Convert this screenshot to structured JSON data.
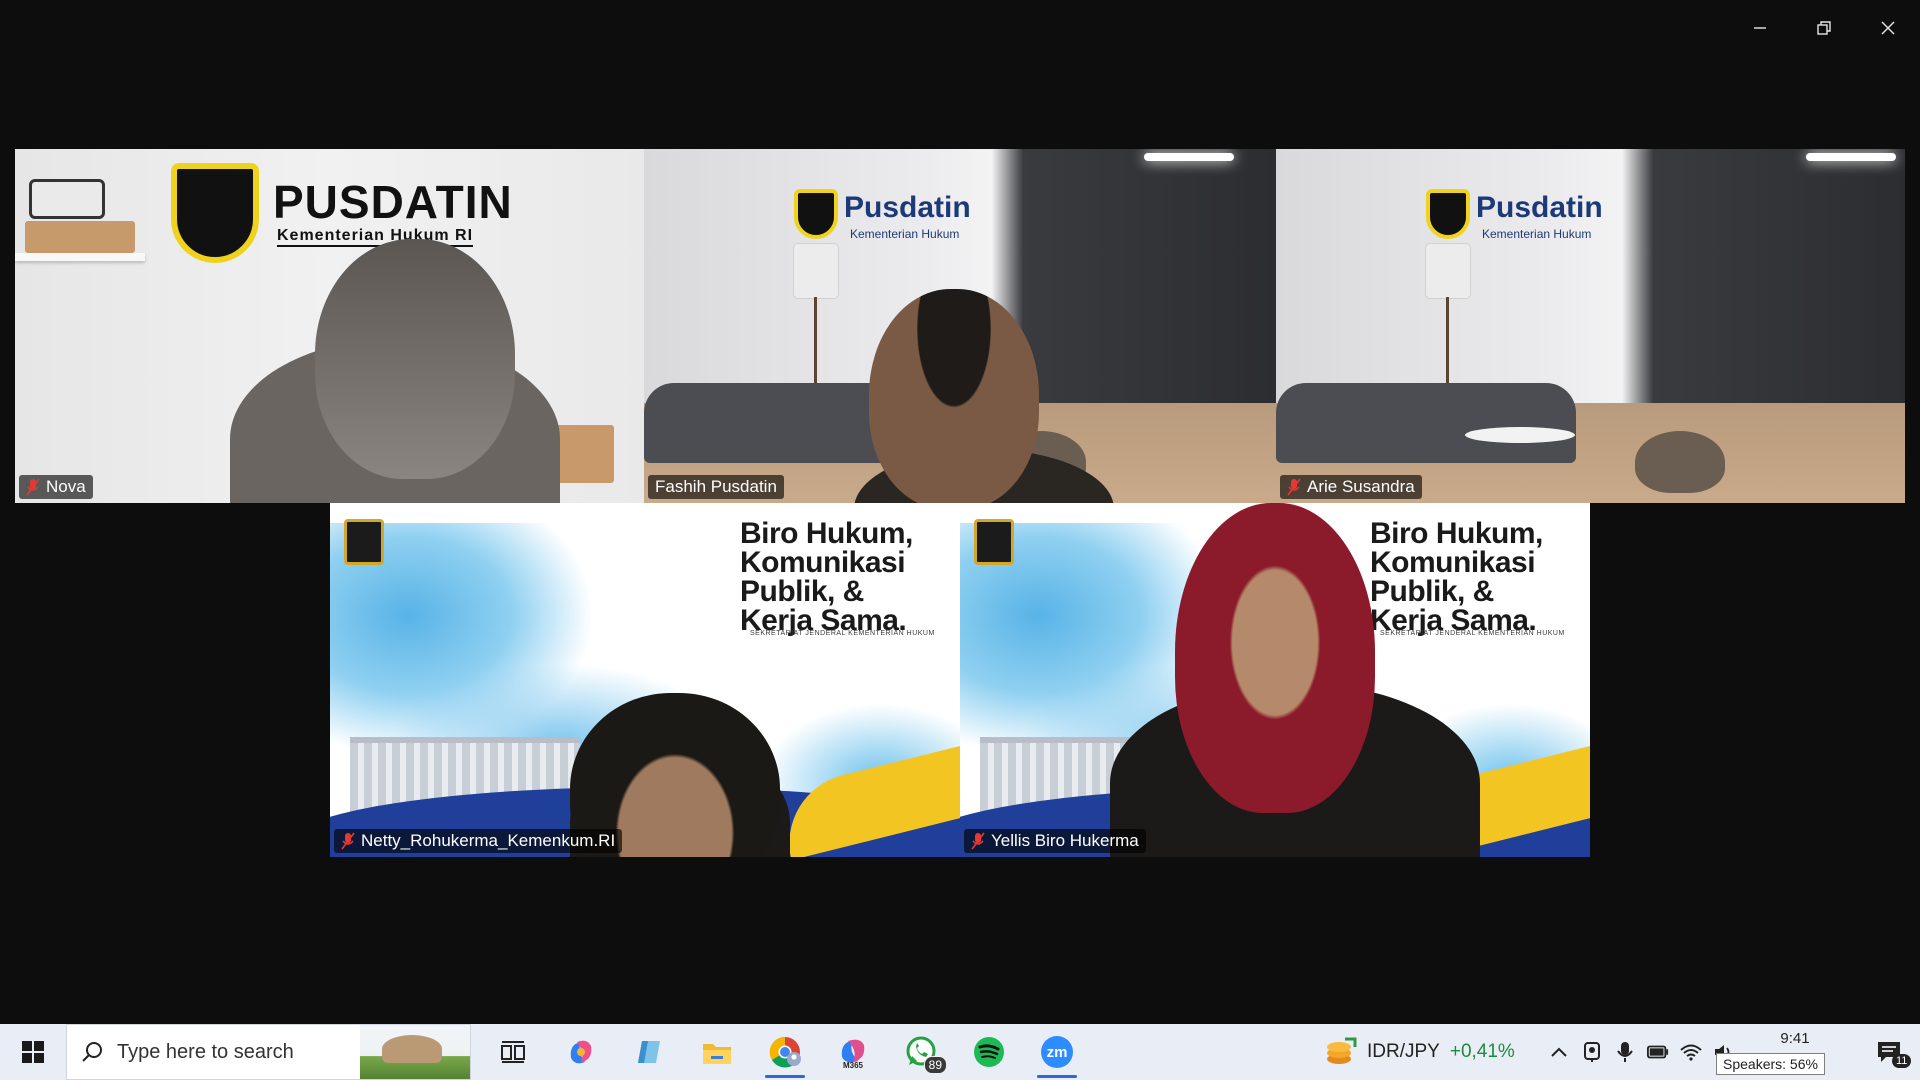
{
  "window": {
    "controls": [
      "minimize",
      "restore",
      "close"
    ]
  },
  "participants": [
    {
      "name": "Nova",
      "muted": true,
      "active": false,
      "background": "pusdatin-shelf"
    },
    {
      "name": "Fashih Pusdatin",
      "muted": false,
      "active": true,
      "background": "pusdatin-office"
    },
    {
      "name": "Arie Susandra",
      "muted": true,
      "active": false,
      "background": "pusdatin-office"
    },
    {
      "name": "Netty_Rohukerma_Kemenkum.RI",
      "muted": true,
      "active": false,
      "background": "biro-hukum"
    },
    {
      "name": "Yellis Biro Hukerma",
      "muted": true,
      "active": false,
      "background": "biro-hukum"
    }
  ],
  "backgrounds": {
    "pusdatin_caps": {
      "title": "PUSDATIN",
      "subtitle": "Kementerian Hukum RI"
    },
    "pusdatin_office": {
      "title": "Pusdatin",
      "subtitle": "Kementerian Hukum"
    },
    "biro": {
      "title_lines": [
        "Biro Hukum,",
        "Komunikasi",
        "Publik, &",
        "Kerja Sama."
      ],
      "subtitle": "SEKRETARIAT JENDERAL KEMENTERIAN HUKUM"
    }
  },
  "colors": {
    "active_speaker": "#2bd86a",
    "mute_red": "#e53935",
    "taskbar_bg": "#e9eef6",
    "ticker_positive": "#1f8a3e"
  },
  "taskbar": {
    "search_placeholder": "Type here to search",
    "apps": [
      {
        "name": "task-view",
        "running": false
      },
      {
        "name": "copilot",
        "running": false
      },
      {
        "name": "notes",
        "running": false
      },
      {
        "name": "file-explorer",
        "running": false
      },
      {
        "name": "chrome",
        "running": true
      },
      {
        "name": "m365",
        "running": false,
        "label": "M365"
      },
      {
        "name": "whatsapp",
        "running": false,
        "badge": "89"
      },
      {
        "name": "spotify",
        "running": false
      },
      {
        "name": "zoom",
        "running": true,
        "label": "zm"
      }
    ],
    "ticker": {
      "pair": "IDR/JPY",
      "change": "+0,41%"
    },
    "time": "9:41",
    "tooltip": "Speakers: 56%",
    "notifications": "11"
  }
}
